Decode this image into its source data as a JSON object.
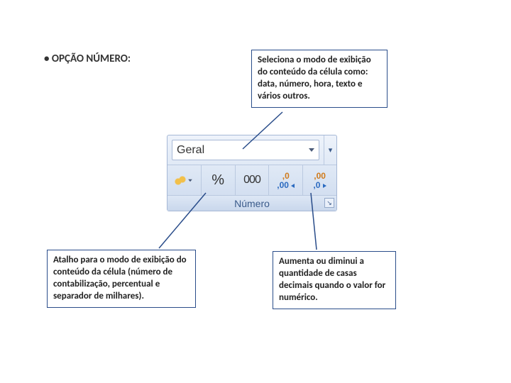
{
  "title": {
    "bullet": "•",
    "text": "OPÇÃO NÚMERO:"
  },
  "notes": {
    "top_right": "Seleciona o modo de exibição do conteúdo da célula como: data, número, hora, texto e vários outros.",
    "bottom_left": "Atalho para o modo de exibição do conteúdo da célula (número de contabilização, percentual e separador de milhares).",
    "bottom_right": "Aumenta ou diminui a quantidade de casas decimais quando o valor for numérico."
  },
  "ribbon": {
    "format_selected": "Geral",
    "group_label": "Número",
    "buttons": {
      "currency": "moeda",
      "percent": "%",
      "thousands": "000",
      "increase_decimal": {
        "top": ",0",
        "bot": ",00"
      },
      "decrease_decimal": {
        "top": ",00",
        "bot": ",0"
      }
    }
  }
}
